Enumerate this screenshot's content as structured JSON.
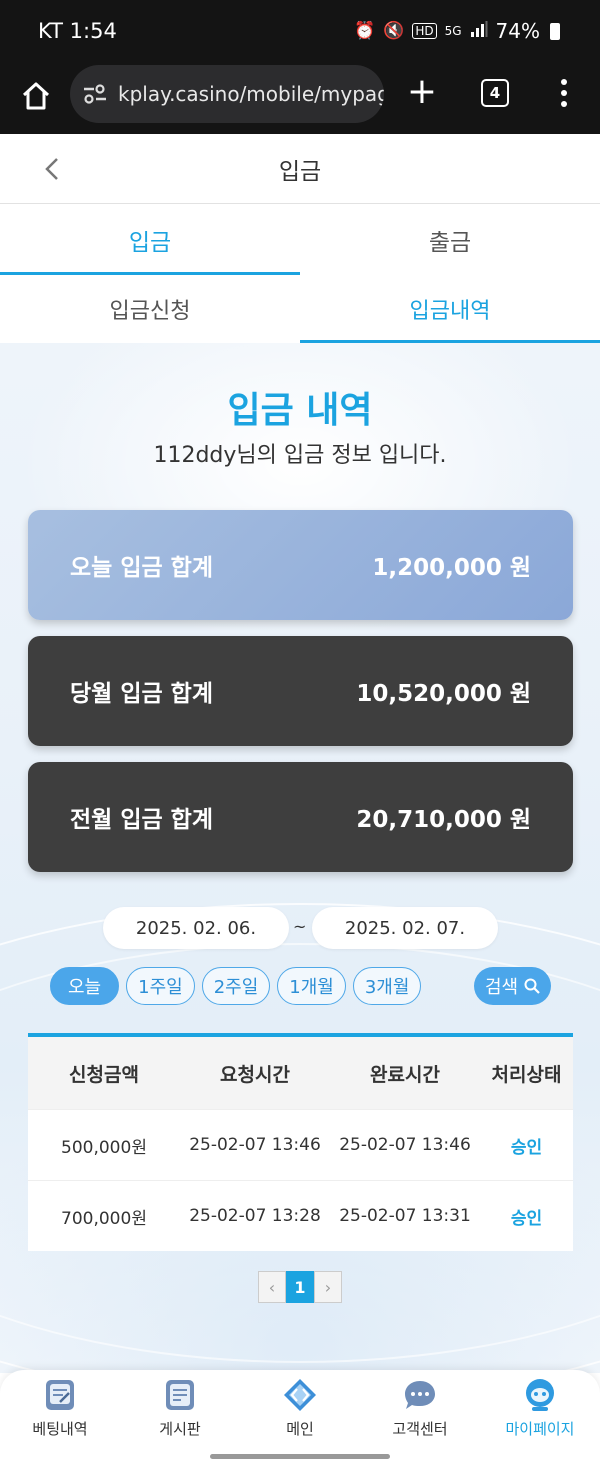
{
  "status_bar": {
    "carrier_time": "KT 1:54",
    "battery": "74%"
  },
  "browser": {
    "url": "kplay.casino/mobile/mypag",
    "tabs_count": "4"
  },
  "header": {
    "title": "입금"
  },
  "main_tabs": [
    {
      "label": "입금"
    },
    {
      "label": "출금"
    }
  ],
  "sub_tabs": [
    {
      "label": "입금신청"
    },
    {
      "label": "입금내역"
    }
  ],
  "section": {
    "title": "입금 내역",
    "subtitle": "112ddy님의 입금 정보 입니다."
  },
  "summary": {
    "today": {
      "label": "오늘 입금 합계",
      "amount": "1,200,000 원"
    },
    "month": {
      "label": "당월 입금 합계",
      "amount": "10,520,000 원"
    },
    "prev": {
      "label": "전월 입금 합계",
      "amount": "20,710,000 원"
    }
  },
  "date_range": {
    "from": "2025. 02. 06.",
    "to": "2025. 02. 07.",
    "separator": "~"
  },
  "quick_filters": [
    {
      "label": "오늘"
    },
    {
      "label": "1주일"
    },
    {
      "label": "2주일"
    },
    {
      "label": "1개월"
    },
    {
      "label": "3개월"
    }
  ],
  "search_label": "검색",
  "table": {
    "headers": [
      "신청금액",
      "요청시간",
      "완료시간",
      "처리상태"
    ],
    "rows": [
      {
        "amount": "500,000원",
        "requested": "25-02-07 13:46",
        "completed": "25-02-07 13:46",
        "status": "승인"
      },
      {
        "amount": "700,000원",
        "requested": "25-02-07 13:28",
        "completed": "25-02-07 13:31",
        "status": "승인"
      }
    ]
  },
  "pagination": {
    "prev": "‹",
    "current": "1",
    "next": "›"
  },
  "bottom_nav": [
    {
      "label": "베팅내역",
      "icon": "betting-history-icon"
    },
    {
      "label": "게시판",
      "icon": "board-icon"
    },
    {
      "label": "메인",
      "icon": "main-icon"
    },
    {
      "label": "고객센터",
      "icon": "chat-icon"
    },
    {
      "label": "마이페이지",
      "icon": "mypage-icon"
    }
  ],
  "colors": {
    "accent": "#1ba3e0",
    "card_dark": "#3e3e3e",
    "card_today": "#9bb4dd"
  }
}
